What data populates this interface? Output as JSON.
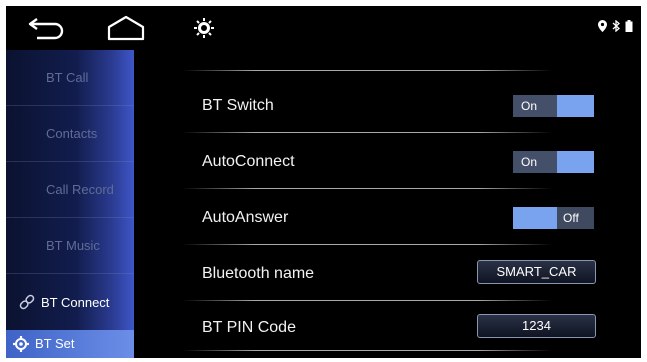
{
  "topbar": {
    "back_icon": "back-arrow-icon",
    "home_icon": "home-icon",
    "settings_icon": "sun-gear-icon",
    "status_icons": [
      "location-icon",
      "bluetooth-icon",
      "battery-icon"
    ]
  },
  "sidebar": {
    "items": [
      {
        "label": "BT Call"
      },
      {
        "label": "Contacts"
      },
      {
        "label": "Call Record"
      },
      {
        "label": "BT Music"
      },
      {
        "label": "BT Connect"
      },
      {
        "label": "BT Set"
      }
    ]
  },
  "settings": {
    "bt_switch": {
      "label": "BT Switch",
      "state": "On"
    },
    "auto_connect": {
      "label": "AutoConnect",
      "state": "On"
    },
    "auto_answer": {
      "label": "AutoAnswer",
      "state": "Off"
    },
    "bluetooth_name": {
      "label": "Bluetooth name",
      "value": "SMART_CAR"
    },
    "bt_pin_code": {
      "label": "BT PIN Code",
      "value": "1234"
    }
  },
  "colors": {
    "accent": "#7aa3ef",
    "active_tab": "#4e72d8",
    "background": "#000000"
  }
}
